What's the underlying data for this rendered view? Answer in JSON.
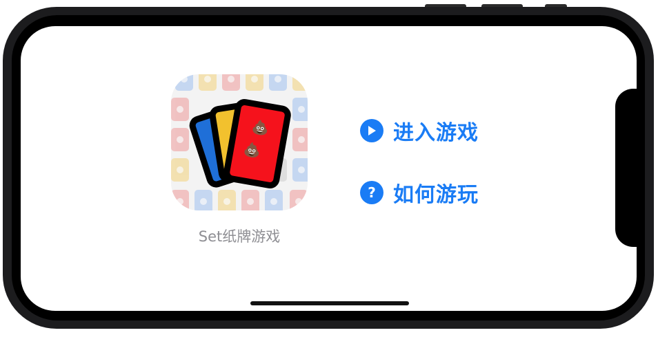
{
  "app_icon": {
    "name": "Set纸牌游戏",
    "card_colors": [
      "#1f6fd8",
      "#f2c12e",
      "#f5121c"
    ],
    "card_symbol": "💩"
  },
  "menu": {
    "items": [
      {
        "label": "进入游戏",
        "icon": "play-circle-icon"
      },
      {
        "label": "如何游玩",
        "icon": "question-circle-icon"
      }
    ]
  },
  "colors": {
    "accent": "#1a7cf5",
    "app_name_text": "#8e8e93",
    "frame": "#1c1c1e"
  }
}
